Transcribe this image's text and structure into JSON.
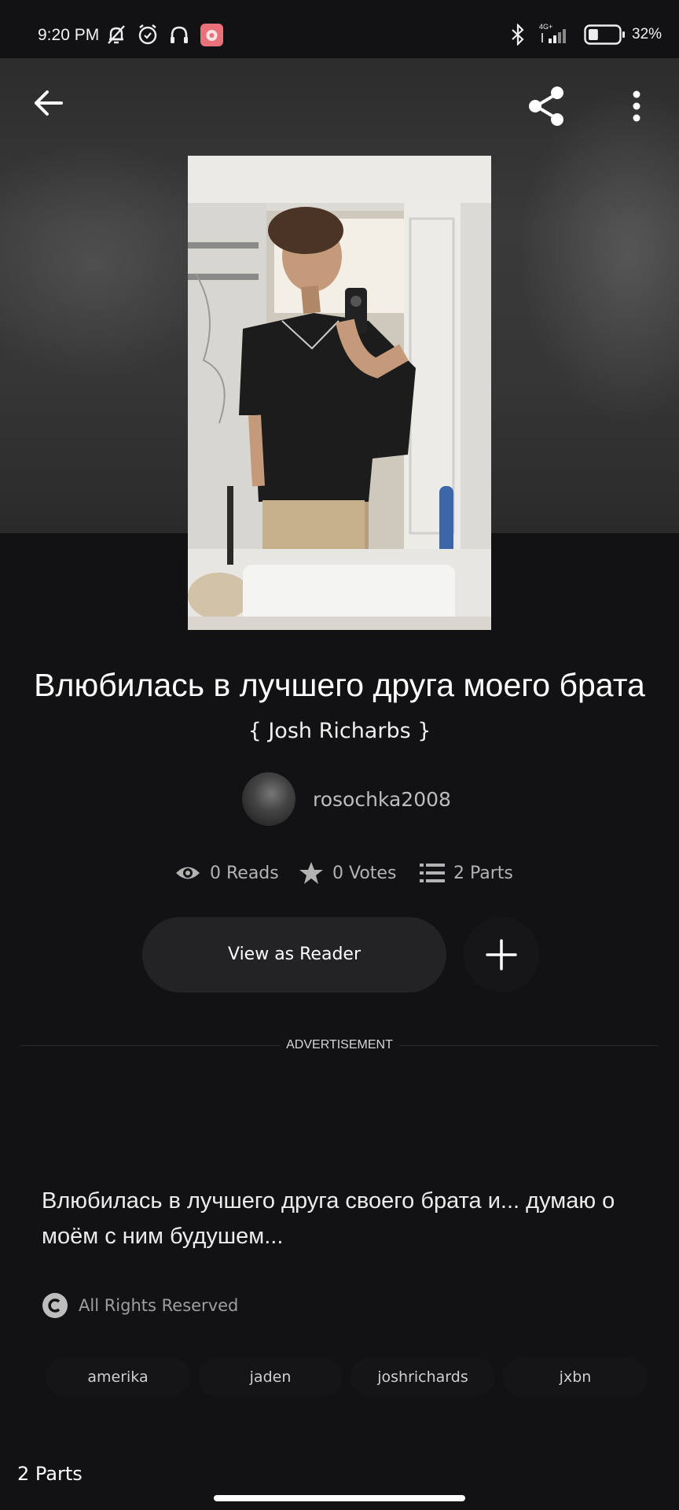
{
  "status_bar": {
    "time": "9:20 PM",
    "network": "4G+",
    "battery": "32%",
    "battery_level": 0.32,
    "icons": [
      "bell-off-icon",
      "alarm-icon",
      "headphones-icon",
      "app-notification-icon",
      "bluetooth-icon",
      "signal-icon",
      "battery-icon"
    ]
  },
  "toolbar": {
    "back_icon": "arrow-left-icon",
    "share_icon": "share-icon",
    "more_icon": "more-vertical-icon"
  },
  "story": {
    "title_main": "Влюбилась в лучшего друга моего брата",
    "title_suffix": "{ Josh Richarbs }",
    "author": "rosochka2008",
    "stats": {
      "reads": "0 Reads",
      "votes": "0 Votes",
      "parts": "2 Parts"
    },
    "description": "Влюбилась в лучшего друга своего брата и... думаю о моём с ним будушем...",
    "rights": "All Rights Reserved",
    "tags": [
      "amerika",
      "jaden",
      "joshrichards",
      "jxbn"
    ]
  },
  "actions": {
    "view_as_reader": "View as Reader",
    "add_icon": "plus-icon"
  },
  "ad": {
    "label": "ADVERTISEMENT"
  },
  "parts_section": {
    "heading": "2 Parts"
  },
  "colors": {
    "background": "#121114",
    "button_bg": "#232225",
    "muted_text": "#b3b3b3"
  }
}
